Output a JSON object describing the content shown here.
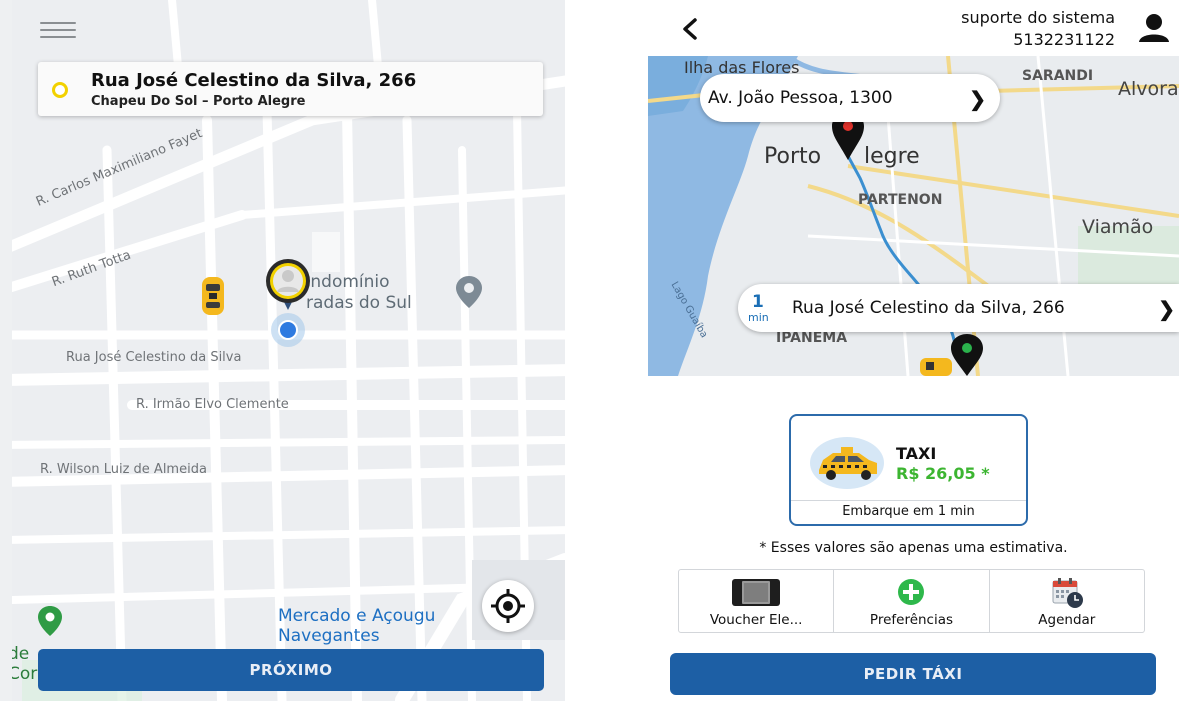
{
  "left_screen": {
    "address_card": {
      "title": "Rua José Celestino da Silva, 266",
      "subtitle": "Chapeu Do Sol – Porto Alegre"
    },
    "map": {
      "streets": {
        "carlos": "R. Carlos Maximiliano Fayet",
        "ruth": "R. Ruth Totta",
        "celestino": "Rua José Celestino da Silva",
        "irmao": "R. Irmão Elvo Clemente",
        "wilson": "R. Wilson Luiz de Almeida"
      },
      "poi_condominio_line1": "ondomínio",
      "poi_condominio_line2": "radas do Sul",
      "poi_mercado_line1": "Mercado e Açougu",
      "poi_mercado_line2": "Navegantes",
      "poi_left_line1": "de",
      "poi_left_line2": "Cor"
    },
    "button_label": "PRÓXIMO"
  },
  "right_screen": {
    "header": {
      "support_name": "suporte do sistema",
      "support_phone": "5132231122"
    },
    "map": {
      "labels": {
        "ilha": "Ilha das Flores",
        "sarandi": "SARANDI",
        "alvorada": "Alvora",
        "porto": "Porto",
        "alegre": "legre",
        "partenon": "PARTENON",
        "viamao": "Viamão",
        "lago": "Lago Guaíba",
        "ipanema": "IPANEMA"
      },
      "destination": "Av. João Pessoa, 1300",
      "origin": "Rua José Celestino da Silva, 266",
      "eta_number": "1",
      "eta_unit": "min"
    },
    "taxi_option": {
      "name": "TAXI",
      "price": "R$ 26,05 *",
      "eta": "Embarque em 1 min"
    },
    "disclaimer": "* Esses valores são apenas uma estimativa.",
    "options": [
      {
        "label": "Voucher Ele...",
        "icon": "voucher-icon"
      },
      {
        "label": "Preferências",
        "icon": "plus-circle-icon"
      },
      {
        "label": "Agendar",
        "icon": "calendar-icon"
      }
    ],
    "button_label": "PEDIR TÁXI"
  },
  "colors": {
    "primary_button": "#1d5fa5",
    "price_green": "#3cb531",
    "pin_yellow": "#f2d100",
    "route_blue": "#3b8fd0"
  }
}
